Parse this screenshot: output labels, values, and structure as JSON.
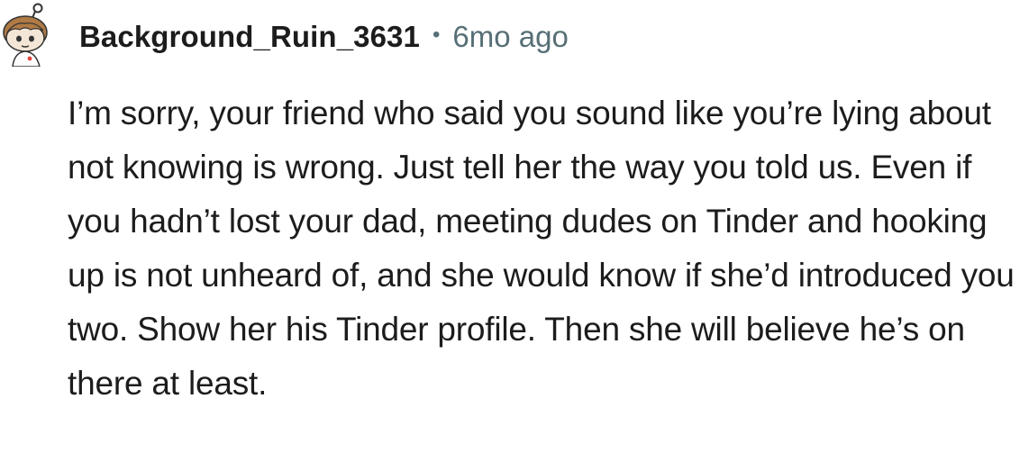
{
  "comment": {
    "author": "Background_Ruin_3631",
    "separator": "•",
    "timestamp": "6mo ago",
    "avatar_icon": "snoo-avatar-icon",
    "body": "I’m sorry, your friend who said you sound like you’re lying about not knowing is wrong. Just tell her the way you told us. Even if you hadn’t lost your dad, meeting dudes on Tinder and hooking up is not unheard of, and she would know if she’d introduced you two. Show her his Tinder profile. Then she will believe he’s on there at least."
  },
  "colors": {
    "text": "#1c1c1c",
    "meta": "#576f76",
    "background": "#ffffff"
  }
}
